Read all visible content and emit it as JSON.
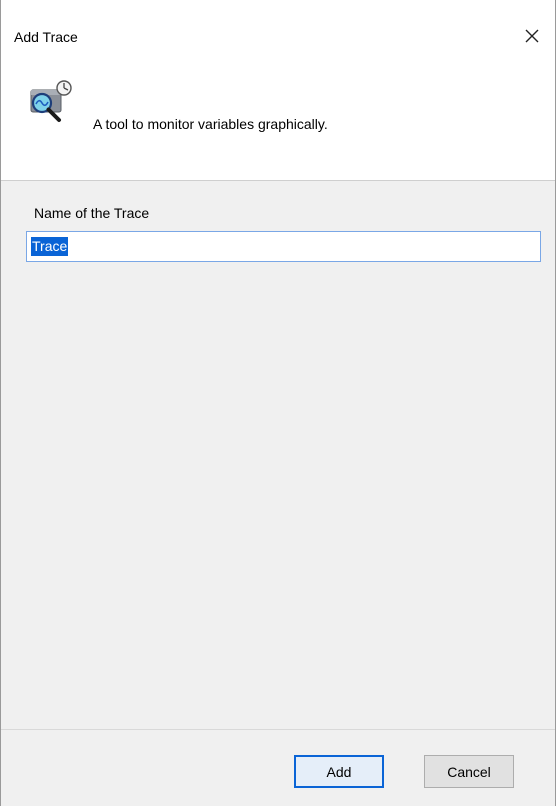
{
  "window": {
    "title": "Add Trace",
    "close_glyph": "✕"
  },
  "header": {
    "icon": "trace-monitor-icon",
    "description": "A tool to monitor variables graphically."
  },
  "form": {
    "name_label": "Name of the Trace",
    "name_value": "Trace"
  },
  "buttons": {
    "add_label": "Add",
    "cancel_label": "Cancel"
  },
  "colors": {
    "accent": "#0a64d6",
    "panel": "#f0f0f0",
    "header": "#ffffff"
  }
}
